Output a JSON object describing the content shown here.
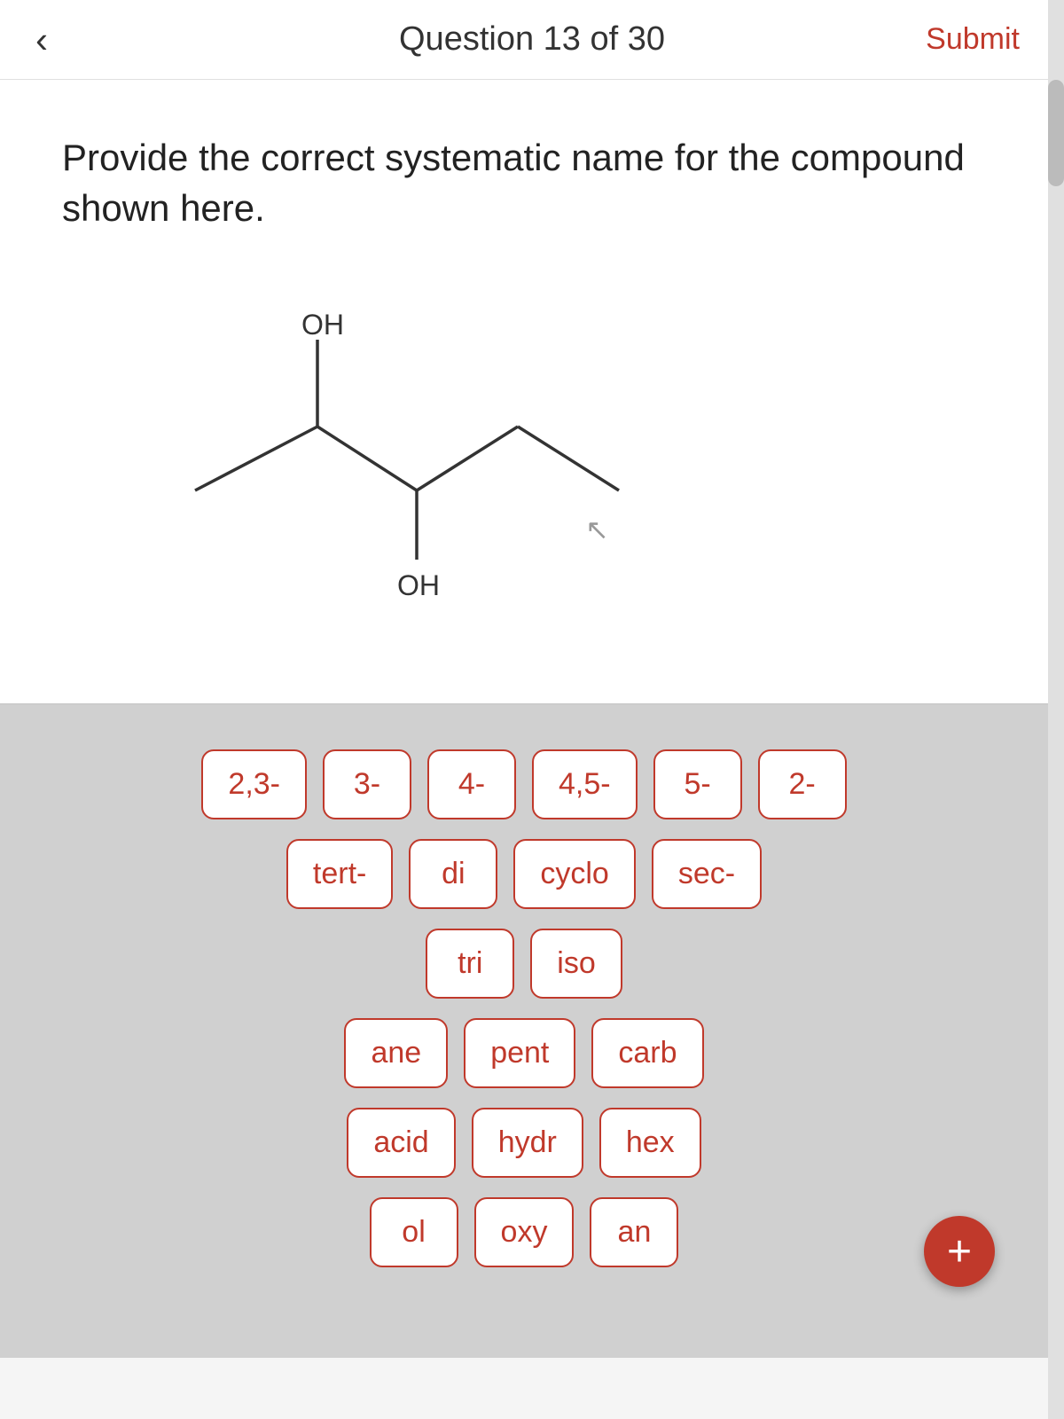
{
  "header": {
    "back_icon": "‹",
    "title": "Question 13 of 30",
    "submit_label": "Submit"
  },
  "question": {
    "text": "Provide the correct systematic name for the compound shown here."
  },
  "tile_rows": [
    [
      "2,3-",
      "3-",
      "4-",
      "4,5-",
      "5-",
      "2-"
    ],
    [
      "tert-",
      "di",
      "cyclo",
      "sec-"
    ],
    [
      "tri",
      "iso"
    ],
    [
      "ane",
      "pent",
      "carb"
    ],
    [
      "acid",
      "hydr",
      "hex"
    ],
    [
      "ol",
      "oxy",
      "an"
    ]
  ],
  "plus_label": "+"
}
